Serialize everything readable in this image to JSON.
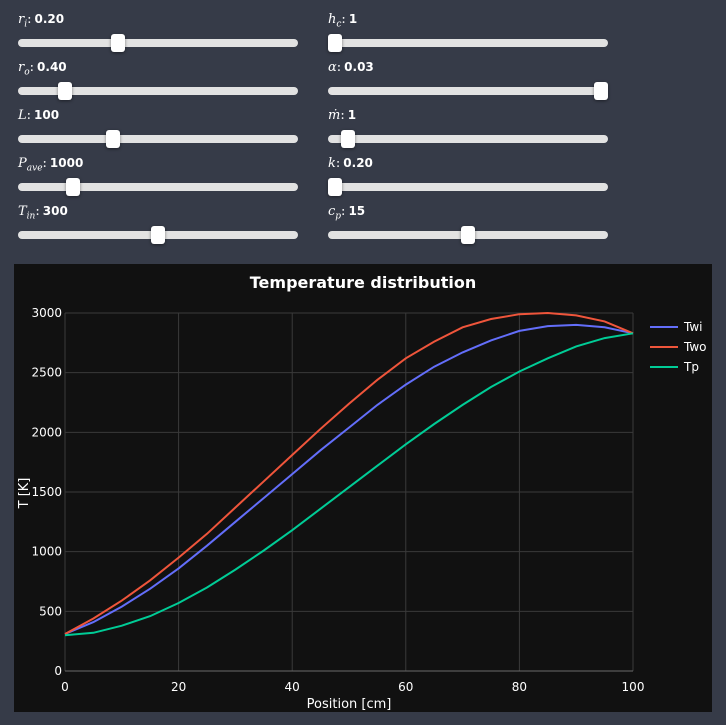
{
  "sliders": {
    "ri": {
      "label_main": "r",
      "label_sub": "i",
      "value": "0.20",
      "fraction": 0.35
    },
    "hc": {
      "label_main": "h",
      "label_sub": "c",
      "value": "1",
      "fraction": 0.0
    },
    "ro": {
      "label_main": "r",
      "label_sub": "o",
      "value": "0.40",
      "fraction": 0.15
    },
    "alpha": {
      "label_main": "α",
      "label_sub": "",
      "value": "0.03",
      "fraction": 1.0
    },
    "L": {
      "label_main": "L",
      "label_sub": "",
      "value": "100",
      "fraction": 0.33
    },
    "mdot": {
      "label_main": "ṁ",
      "label_sub": "",
      "value": "1",
      "fraction": 0.05
    },
    "pave": {
      "label_main": "P",
      "label_sub": "ave",
      "value": "1000",
      "fraction": 0.18
    },
    "k": {
      "label_main": "k",
      "label_sub": "",
      "value": "0.20",
      "fraction": 0.0
    },
    "tin": {
      "label_main": "T",
      "label_sub": "in",
      "value": "300",
      "fraction": 0.5
    },
    "cp": {
      "label_main": "c",
      "label_sub": "p",
      "value": "15",
      "fraction": 0.5
    }
  },
  "colors": {
    "Twi": "#636efa",
    "Two": "#ef553b",
    "Tp": "#00cc96",
    "page_bg": "#363b48",
    "chart_bg": "#111111"
  },
  "chart_data": {
    "type": "line",
    "title": "Temperature distribution",
    "xlabel": "Position [cm]",
    "ylabel": "T [K]",
    "xlim": [
      0,
      100
    ],
    "ylim": [
      0,
      3000
    ],
    "xticks": [
      0,
      20,
      40,
      60,
      80,
      100
    ],
    "yticks": [
      0,
      500,
      1000,
      1500,
      2000,
      2500,
      3000
    ],
    "grid": true,
    "legend_position": "top-right",
    "x": [
      0,
      5,
      10,
      15,
      20,
      25,
      30,
      35,
      40,
      45,
      50,
      55,
      60,
      65,
      70,
      75,
      80,
      85,
      90,
      95,
      100
    ],
    "series": [
      {
        "name": "Twi",
        "values": [
          310,
          410,
          540,
          690,
          860,
          1050,
          1250,
          1450,
          1650,
          1850,
          2040,
          2230,
          2400,
          2550,
          2670,
          2770,
          2850,
          2890,
          2900,
          2880,
          2830
        ]
      },
      {
        "name": "Two",
        "values": [
          310,
          440,
          590,
          760,
          950,
          1150,
          1370,
          1590,
          1810,
          2030,
          2240,
          2440,
          2620,
          2760,
          2880,
          2950,
          2990,
          3000,
          2980,
          2930,
          2830
        ]
      },
      {
        "name": "Tp",
        "values": [
          300,
          320,
          380,
          460,
          570,
          700,
          850,
          1010,
          1180,
          1360,
          1540,
          1720,
          1900,
          2070,
          2230,
          2380,
          2510,
          2620,
          2720,
          2790,
          2830
        ]
      }
    ]
  }
}
